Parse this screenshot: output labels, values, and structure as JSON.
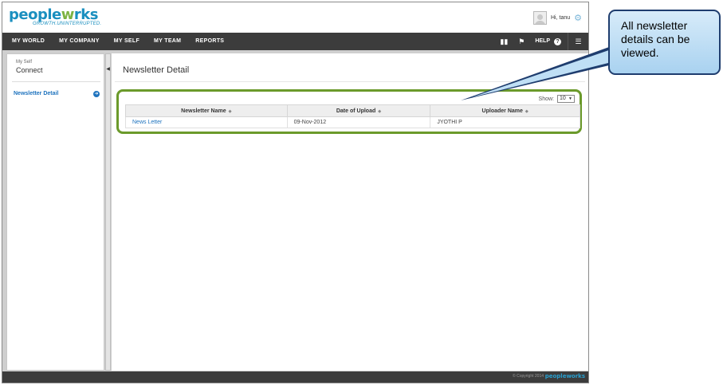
{
  "header": {
    "logo_main": "pe",
    "logo_o": "o",
    "logo_mid": "ple",
    "logo_w": "w",
    "logo_end": "rks",
    "tagline": "GROWTH.UNINTERRUPTED.",
    "greeting": "Hi, tanu"
  },
  "nav": {
    "items": [
      {
        "label": "MY WORLD"
      },
      {
        "label": "MY COMPANY"
      },
      {
        "label": "MY SELF"
      },
      {
        "label": "MY TEAM"
      },
      {
        "label": "REPORTS"
      }
    ],
    "help_label": "HELP"
  },
  "sidebar": {
    "section_small": "My Self",
    "section_title": "Connect",
    "items": [
      {
        "label": "Newsletter Detail"
      }
    ]
  },
  "main": {
    "page_title": "Newsletter Detail",
    "show_label": "Show:",
    "show_value": "10",
    "columns": [
      "Newsletter Name",
      "Date of Upload",
      "Uploader Name"
    ],
    "rows": [
      {
        "name": "News Letter",
        "date": "09-Nov-2012",
        "uploader": "JYOTHI P"
      }
    ]
  },
  "footer": {
    "copyright": "© Copyright 2014",
    "logo": "peopleworks"
  },
  "callout": {
    "text": "All newsletter details can be viewed."
  },
  "colors": {
    "brand_blue": "#1a8fbf",
    "brand_green": "#7cb342",
    "nav_bg": "#3c3c3c",
    "highlight_border": "#6b9a2b",
    "link": "#1e73be",
    "callout_border": "#1f3d6e"
  },
  "icons": {
    "gear": "gear-icon",
    "help": "help-icon",
    "menu": "menu-icon",
    "arrow": "arrow-right-icon"
  }
}
